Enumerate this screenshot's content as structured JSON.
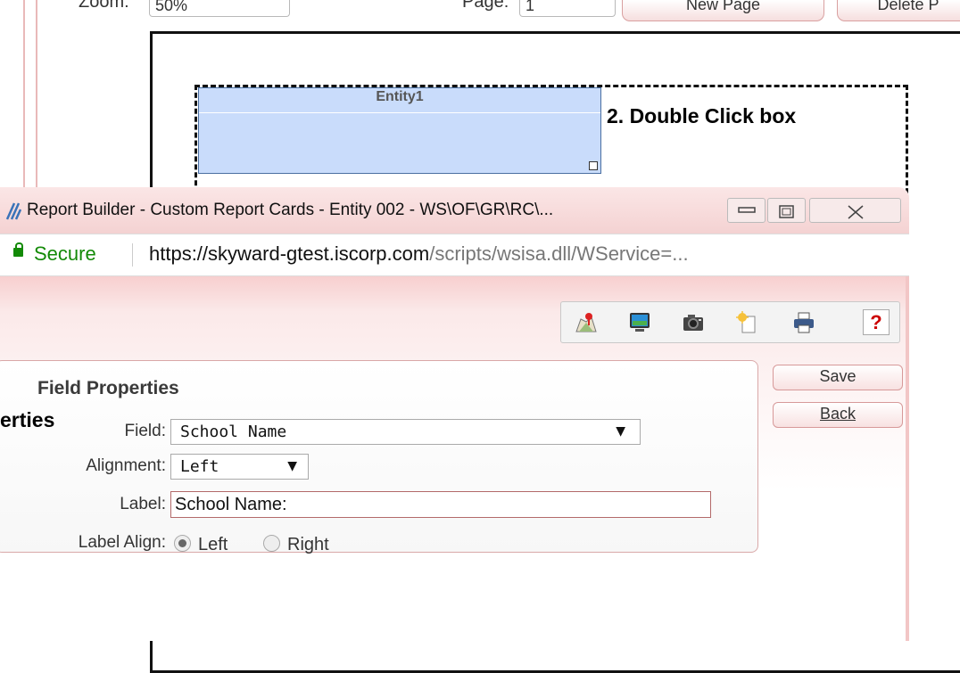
{
  "background": {
    "zoom_label": "Zoom:",
    "zoom_value": "50%",
    "page_label": "Page:",
    "page_value": "1",
    "new_page_button": "New Page",
    "delete_button": "Delete P",
    "entity_title": "Entity1",
    "annotation_text": "2. Double Click box",
    "clipped_text": "erties"
  },
  "window": {
    "title": "Report Builder - Custom Report Cards - Entity 002 - WS\\OF\\GR\\RC\\...",
    "secure_label": "Secure",
    "url_host": "https://skyward-gtest.iscorp.com",
    "url_path": "/scripts/wsisa.dll/WService=..."
  },
  "toolbar": {
    "icons": [
      "map-icon",
      "monitor-icon",
      "camera-icon",
      "new-document-icon",
      "print-icon",
      "help-icon"
    ],
    "help_label": "?"
  },
  "form": {
    "title": "Field Properties",
    "field_label": "Field:",
    "field_value": "School Name",
    "alignment_label": "Alignment:",
    "alignment_value": "Left",
    "label_label": "Label:",
    "label_value": "School Name:",
    "label_align_label": "Label Align:",
    "radio_left": "Left",
    "radio_right": "Right",
    "save_label": "Save",
    "back_label": "Back"
  }
}
